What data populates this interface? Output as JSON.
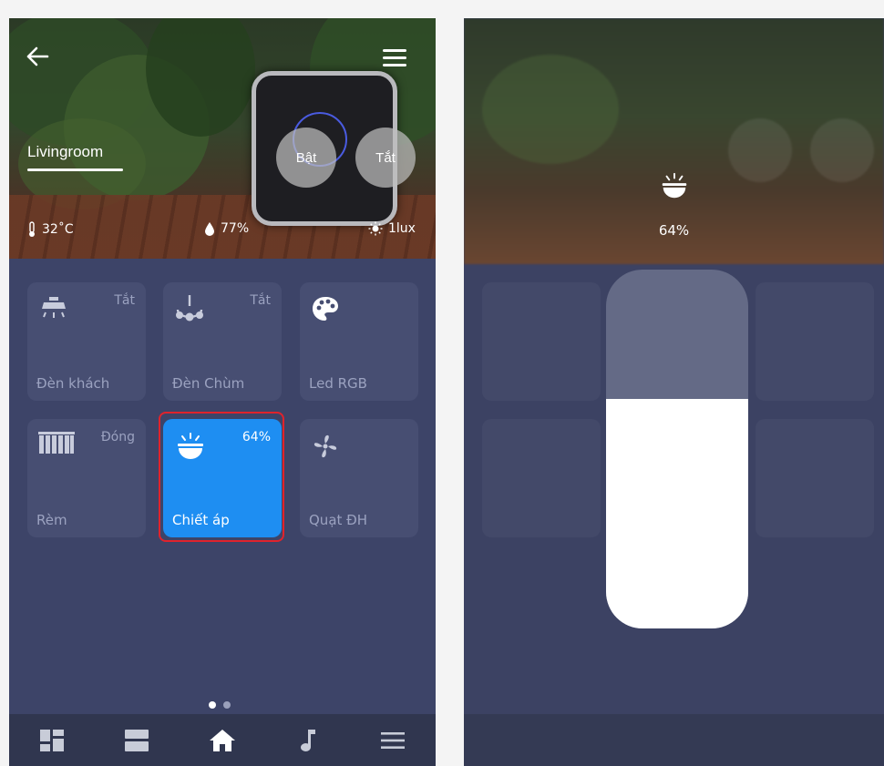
{
  "left": {
    "room_name": "Livingroom",
    "buttons": {
      "on_label": "Bật",
      "off_label": "Tắt"
    },
    "sensors": [
      {
        "icon": "thermometer-icon",
        "value": "32˚C"
      },
      {
        "icon": "humidity-drop-icon",
        "value": "77%"
      },
      {
        "icon": "sun-icon",
        "value": "1lux"
      }
    ],
    "devices": [
      {
        "name": "Đèn khách",
        "state": "Tắt",
        "icon": "ceiling-light-icon"
      },
      {
        "name": "Đèn Chùm",
        "state": "Tắt",
        "icon": "chandelier-icon"
      },
      {
        "name": "Led RGB",
        "state": "",
        "icon": "palette-icon"
      },
      {
        "name": "Rèm",
        "state": "Đóng",
        "icon": "curtain-icon"
      },
      {
        "name": "Chiết áp",
        "state": "64%",
        "icon": "dimmer-lamp-icon",
        "active": true
      },
      {
        "name": "Quạt ĐH",
        "state": "",
        "icon": "fan-icon"
      }
    ],
    "page_indicator": {
      "current": 1,
      "total": 2
    },
    "tabs": [
      "dashboard-icon",
      "rooms-icon",
      "home-icon",
      "music-icon",
      "menu-icon"
    ]
  },
  "right": {
    "dimmer_percent_label": "64%",
    "dimmer_level": 0.64
  },
  "colors": {
    "accent": "#1e8ef2",
    "highlight": "#e0232c",
    "background": "#3d4468"
  }
}
